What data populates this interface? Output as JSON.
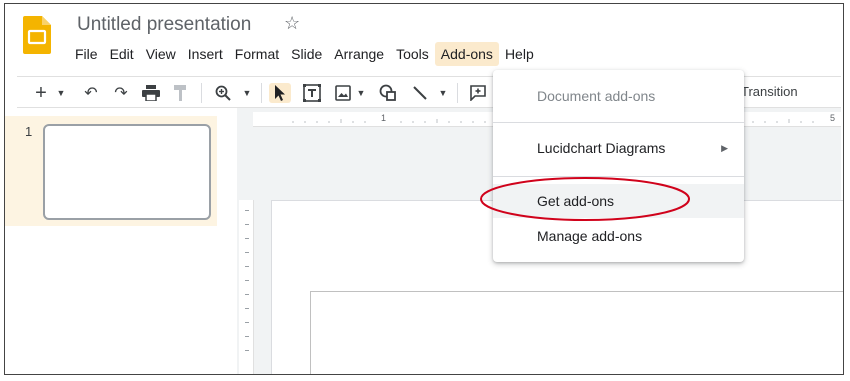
{
  "header": {
    "title": "Untitled presentation",
    "star_icon": "star-outline-icon",
    "logo_icon": "google-slides-logo",
    "logo_color": "#f4b400"
  },
  "menubar": {
    "items": [
      "File",
      "Edit",
      "View",
      "Insert",
      "Format",
      "Slide",
      "Arrange",
      "Tools",
      "Add-ons",
      "Help"
    ],
    "active": "Add-ons",
    "active_color": "#fbeacd"
  },
  "toolbar": {
    "icons": [
      "new-slide-icon",
      "caret-down-icon",
      "undo-icon",
      "redo-icon",
      "print-icon",
      "paint-format-icon",
      "zoom-icon",
      "caret-down-icon",
      "select-cursor-icon",
      "text-box-icon",
      "image-icon",
      "caret-down-icon",
      "shape-icon",
      "line-icon",
      "caret-down-icon",
      "comment-icon"
    ],
    "transition_label": "Transition"
  },
  "filmstrip": {
    "slides": [
      {
        "number": "1"
      }
    ]
  },
  "ruler": {
    "marks": [
      "1",
      "5"
    ]
  },
  "dropdown": {
    "items": [
      {
        "label": "Document add-ons",
        "enabled": false
      },
      {
        "label": "Lucidchart Diagrams",
        "enabled": true,
        "submenu": true
      },
      {
        "label": "Get add-ons",
        "enabled": true,
        "highlighted": true
      },
      {
        "label": "Manage add-ons",
        "enabled": true
      }
    ]
  },
  "annotation": {
    "color": "#d0021b",
    "target": "Get add-ons"
  }
}
